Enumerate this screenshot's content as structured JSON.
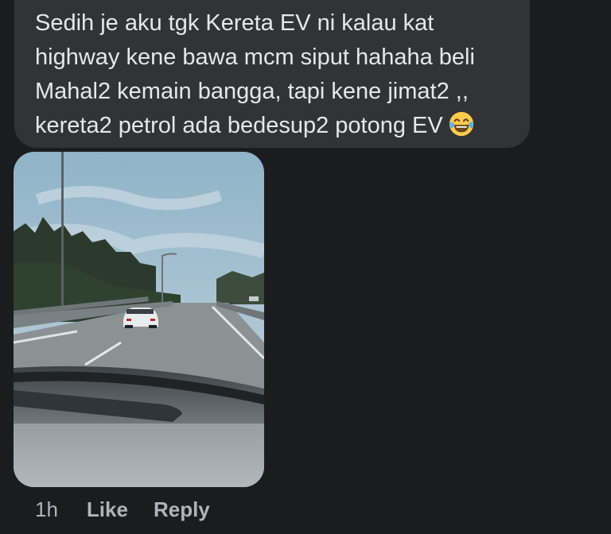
{
  "comment": {
    "text_lines": [
      "Sedih je aku tgk Kereta EV ni kalau kat",
      "highway kene bawa mcm siput hahaha beli",
      "Mahal2 kemain bangga, tapi kene jimat2 ,,",
      "kereta2 petrol ada bedesup2 potong EV"
    ],
    "emoji": "laughing-tears-emoji"
  },
  "photo": {
    "icon": "highway-car-photo"
  },
  "meta": {
    "time": "1h",
    "like_label": "Like",
    "reply_label": "Reply"
  },
  "colors": {
    "background": "#1b1c1e",
    "bubble": "#323335",
    "text": "#e6e7ea",
    "secondary": "#b0b3b8"
  }
}
